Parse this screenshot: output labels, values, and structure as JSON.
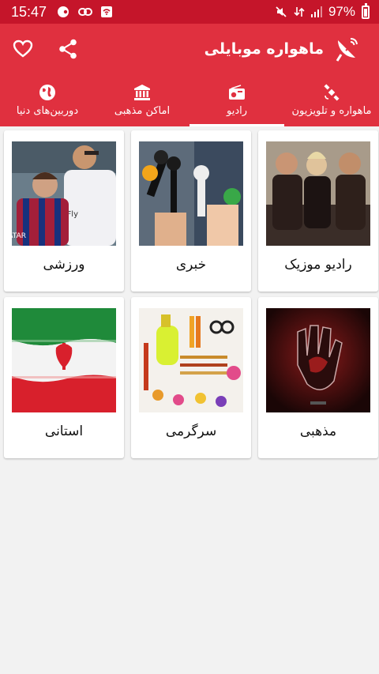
{
  "status": {
    "time": "15:47",
    "battery": "97%"
  },
  "app": {
    "title": "ماهواره موبایلی"
  },
  "tabs": [
    {
      "label": "ماهواره و تلویزیون",
      "icon": "satellite-icon",
      "active": false
    },
    {
      "label": "رادیو",
      "icon": "radio-icon",
      "active": true
    },
    {
      "label": "اماکن مذهبی",
      "icon": "bank-icon",
      "active": false
    },
    {
      "label": "دوربین‌های دنیا",
      "icon": "globe-icon",
      "active": false
    }
  ],
  "categories": [
    {
      "label": "رادیو موزیک"
    },
    {
      "label": "خبری"
    },
    {
      "label": "ورزشی"
    },
    {
      "label": "مذهبی"
    },
    {
      "label": "سرگرمی"
    },
    {
      "label": "استانی"
    }
  ],
  "colors": {
    "status_bar": "#c5152a",
    "app_bar": "#e0303f",
    "background": "#f2f2f2"
  }
}
